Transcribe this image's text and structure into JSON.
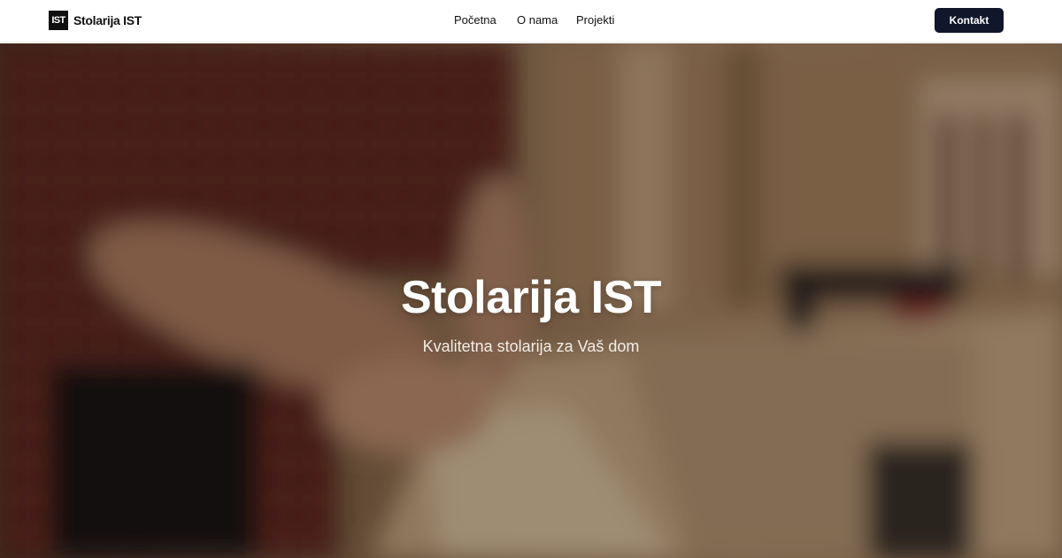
{
  "brand": {
    "logo_text": "IST",
    "name": "Stolarija IST"
  },
  "nav": {
    "items": [
      {
        "label": "Početna"
      },
      {
        "label": "O nama"
      },
      {
        "label": "Projekti"
      }
    ]
  },
  "cta": {
    "label": "Kontakt"
  },
  "hero": {
    "title": "Stolarija IST",
    "subtitle": "Kvalitetna stolarija za Vaš dom",
    "background": "blurred-carpentry-workshop-photo"
  },
  "colors": {
    "header_bg": "#ffffff",
    "cta_bg": "#10172a",
    "cta_text": "#ffffff",
    "hero_text": "#ffffff"
  }
}
